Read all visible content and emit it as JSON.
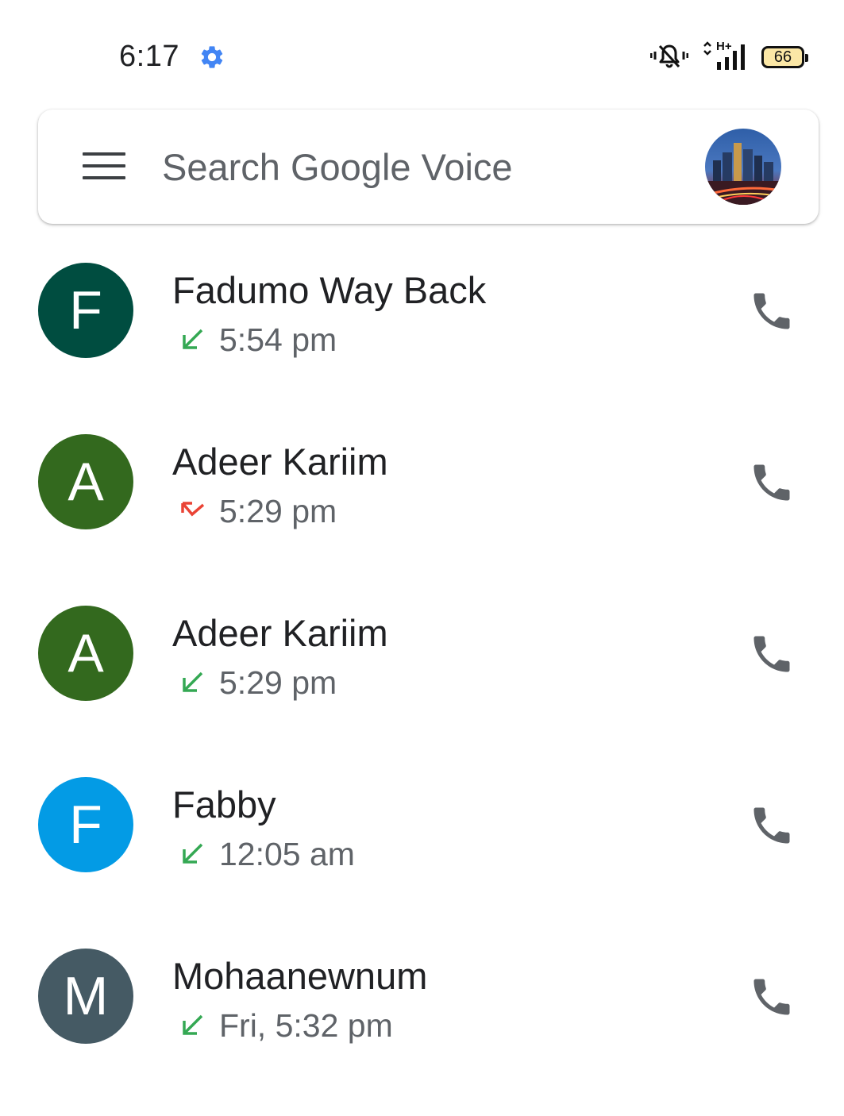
{
  "status_bar": {
    "time": "6:17",
    "battery_level": "66",
    "network_label": "H+",
    "icons": [
      "gear-icon",
      "vibrate-mute-icon",
      "data-arrows-icon",
      "signal-icon",
      "battery-icon"
    ]
  },
  "search": {
    "placeholder": "Search Google Voice",
    "menu_icon": "hamburger-menu-icon",
    "account_avatar": "city-skyline-avatar"
  },
  "calls": [
    {
      "initial": "F",
      "name": "Fadumo Way Back",
      "time": "5:54 pm",
      "direction": "incoming",
      "avatar_color": "#004d40"
    },
    {
      "initial": "A",
      "name": "Adeer Kariim",
      "time": "5:29 pm",
      "direction": "missed",
      "avatar_color": "#33691e"
    },
    {
      "initial": "A",
      "name": "Adeer Kariim",
      "time": "5:29 pm",
      "direction": "incoming",
      "avatar_color": "#33691e"
    },
    {
      "initial": "F",
      "name": "Fabby",
      "time": "12:05 am",
      "direction": "incoming",
      "avatar_color": "#039be5"
    },
    {
      "initial": "M",
      "name": "Mohaanewnum",
      "time": "Fri, 5:32 pm",
      "direction": "incoming",
      "avatar_color": "#455a64"
    }
  ],
  "colors": {
    "incoming_arrow": "#34a853",
    "missed_arrow": "#ea4335",
    "phone_icon": "#5f6368",
    "gear_icon": "#4285f4",
    "battery_fill": "#fbe7a6"
  }
}
